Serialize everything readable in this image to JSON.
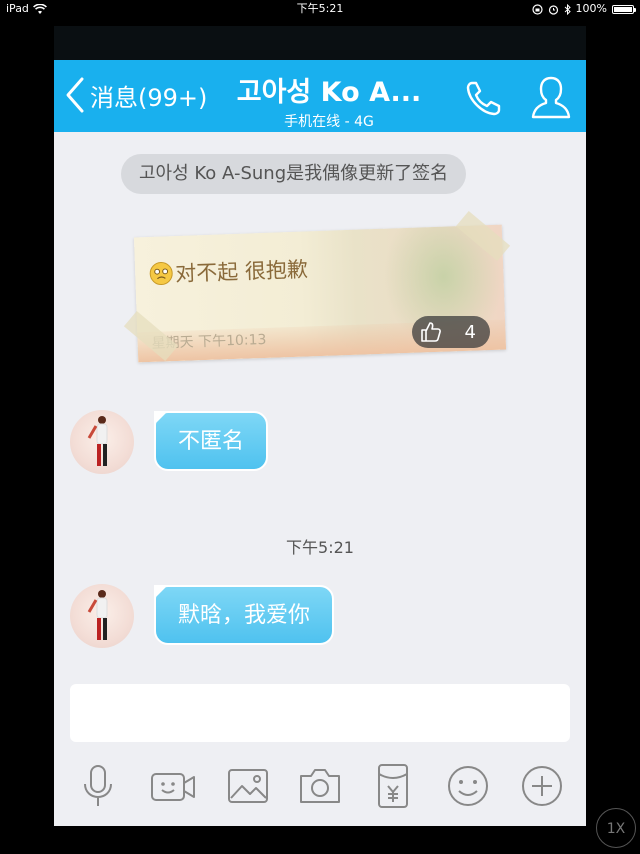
{
  "status_bar": {
    "device": "iPad",
    "time": "下午5:21",
    "battery": "100%"
  },
  "header": {
    "back_label": "消息(99+)",
    "title": "고아성 Ko A...",
    "subtitle": "手机在线 - 4G"
  },
  "system_message": "고아성 Ko A-Sung是我偶像更新了签名",
  "signature_card": {
    "text": "对不起 很抱歉",
    "time": "星期天 下午10:13",
    "likes": "4"
  },
  "messages": [
    {
      "text": "不匿名"
    },
    {
      "text": "默晗，我爱你"
    }
  ],
  "timestamp": "下午5:21",
  "input": {
    "placeholder": ""
  },
  "playback_speed": "1X",
  "colors": {
    "accent": "#19b0ee",
    "bubble": "#5ecaf2",
    "background": "#eeeff3"
  },
  "icons": [
    "back-chevron-icon",
    "phone-icon",
    "profile-icon",
    "microphone-icon",
    "video-icon",
    "image-icon",
    "camera-icon",
    "red-packet-icon",
    "emoji-icon",
    "plus-icon"
  ]
}
